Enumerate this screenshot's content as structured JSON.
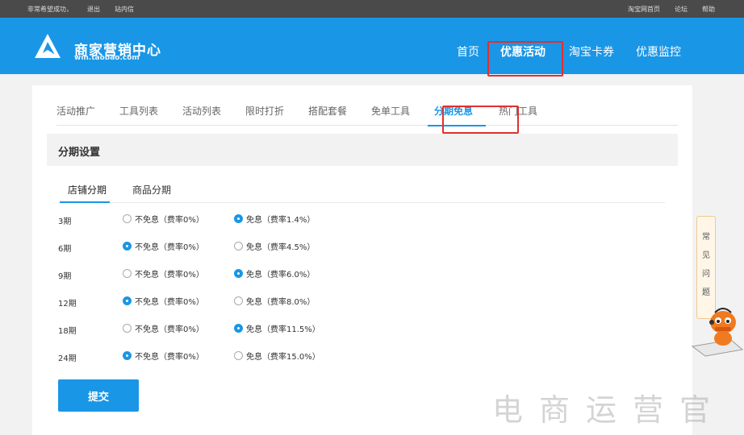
{
  "topbar": {
    "left_items": [
      "非常希望成功，",
      "退出",
      "站内信"
    ],
    "right_items": [
      "淘宝网首页",
      "论坛",
      "帮助"
    ]
  },
  "brand": {
    "name": "商家营销中心",
    "domain": "win.taobao.com"
  },
  "nav": {
    "items": [
      "首页",
      "优惠活动",
      "淘宝卡券",
      "优惠监控"
    ],
    "active": "优惠活动"
  },
  "tabs": {
    "items": [
      "活动推广",
      "工具列表",
      "活动列表",
      "限时打折",
      "搭配套餐",
      "免单工具",
      "分期免息",
      "热门工具"
    ],
    "active": "分期免息"
  },
  "settings": {
    "title": "分期设置",
    "subtabs": [
      "店铺分期",
      "商品分期"
    ],
    "active_subtab": "店铺分期",
    "rows": [
      {
        "period": "3期",
        "opt1": "不免息（费率0%）",
        "opt2": "免息（费率1.4%）",
        "selected": 2
      },
      {
        "period": "6期",
        "opt1": "不免息（费率0%）",
        "opt2": "免息（费率4.5%）",
        "selected": 1
      },
      {
        "period": "9期",
        "opt1": "不免息（费率0%）",
        "opt2": "免息（费率6.0%）",
        "selected": 2
      },
      {
        "period": "12期",
        "opt1": "不免息（费率0%）",
        "opt2": "免息（费率8.0%）",
        "selected": 1
      },
      {
        "period": "18期",
        "opt1": "不免息（费率0%）",
        "opt2": "免息（费率11.5%）",
        "selected": 2
      },
      {
        "period": "24期",
        "opt1": "不免息（费率0%）",
        "opt2": "免息（费率15.0%）",
        "selected": 1
      }
    ],
    "submit_label": "提交"
  },
  "faq": {
    "chars": [
      "常",
      "见",
      "问",
      "题"
    ]
  },
  "watermark": "电商运营官",
  "colors": {
    "accent": "#1a96e6",
    "highlight": "#e03030",
    "topbar": "#4a4a4a"
  }
}
